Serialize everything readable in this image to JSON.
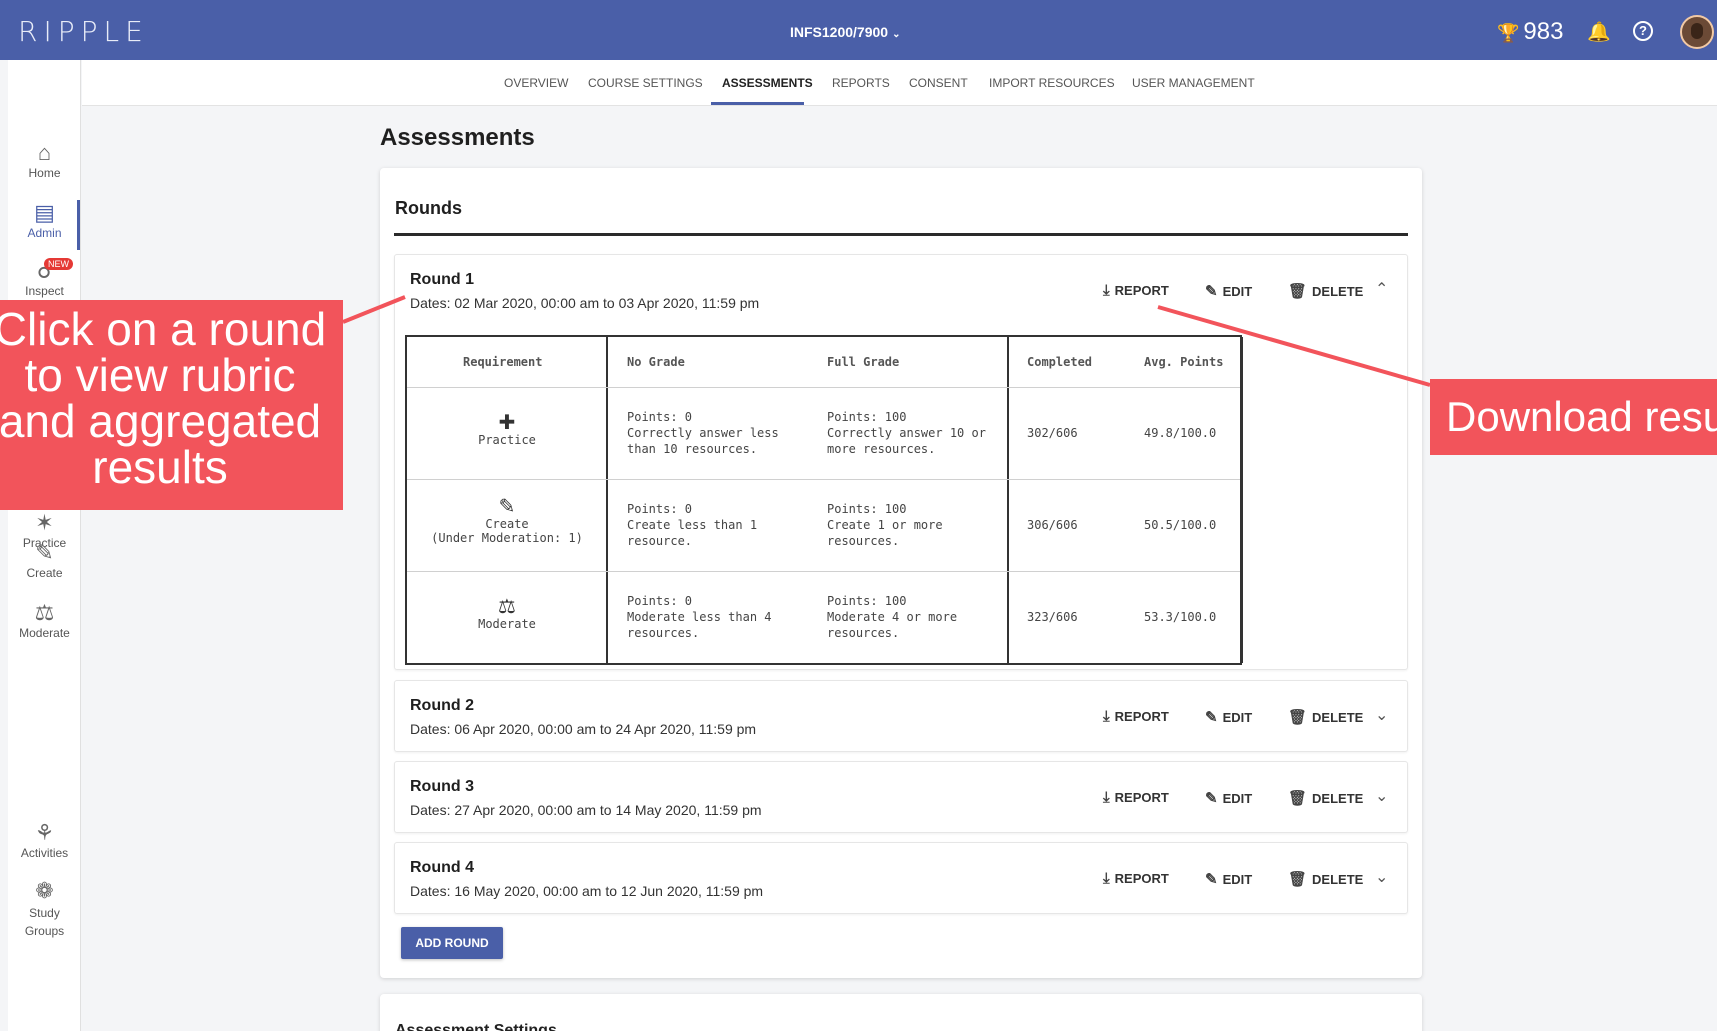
{
  "app": {
    "logo": "RIPPLE",
    "course": "INFS1200/7900",
    "points": "983",
    "icons": {
      "trophy": "trophy-icon",
      "bell": "bell-icon",
      "help": "help-icon"
    }
  },
  "sidebar": {
    "items": [
      {
        "label": "Home",
        "icon": "home-icon"
      },
      {
        "label": "Admin",
        "icon": "admin-icon"
      },
      {
        "label": "Inspect",
        "icon": "inspect-icon",
        "badge": "NEW"
      },
      {
        "label": "Practice",
        "icon": "practice-icon"
      },
      {
        "label": "Create",
        "icon": "create-icon"
      },
      {
        "label": "Moderate",
        "icon": "moderate-icon"
      },
      {
        "label": "Activities",
        "icon": "activities-icon"
      },
      {
        "label": "Study Groups",
        "icon": "study-groups-icon"
      }
    ]
  },
  "tabs": [
    "OVERVIEW",
    "COURSE SETTINGS",
    "ASSESSMENTS",
    "REPORTS",
    "CONSENT",
    "IMPORT RESOURCES",
    "USER MANAGEMENT"
  ],
  "active_tab": "ASSESSMENTS",
  "page": {
    "title": "Assessments",
    "rounds_title": "Rounds",
    "actions": {
      "report": "REPORT",
      "edit": "EDIT",
      "delete": "DELETE"
    },
    "add_round": "ADD ROUND",
    "next_section": "Assessment Settings"
  },
  "rounds": [
    {
      "name": "Round 1",
      "dates": "Dates: 02 Mar 2020, 00:00 am to 03 Apr 2020, 11:59 pm",
      "expanded": true
    },
    {
      "name": "Round 2",
      "dates": "Dates: 06 Apr 2020, 00:00 am to 24 Apr 2020, 11:59 pm",
      "expanded": false
    },
    {
      "name": "Round 3",
      "dates": "Dates: 27 Apr 2020, 00:00 am to 14 May 2020, 11:59 pm",
      "expanded": false
    },
    {
      "name": "Round 4",
      "dates": "Dates: 16 May 2020, 00:00 am to 12 Jun 2020, 11:59 pm",
      "expanded": false
    }
  ],
  "rubric": {
    "headers": [
      "Requirement",
      "No Grade",
      "Full Grade",
      "Completed",
      "Avg. Points"
    ],
    "rows": [
      {
        "requirement": "Practice",
        "sub": "",
        "icon": "dumbbell-icon",
        "no_grade": [
          "Points: 0",
          "Correctly answer less",
          "than 10 resources."
        ],
        "full_grade": [
          "Points: 100",
          "Correctly answer 10 or",
          "more resources."
        ],
        "completed": "302/606",
        "avg": "49.8/100.0"
      },
      {
        "requirement": "Create",
        "sub": "(Under Moderation: 1)",
        "icon": "pencil-icon",
        "no_grade": [
          "Points: 0",
          "Create less than 1",
          "resource."
        ],
        "full_grade": [
          "Points: 100",
          "Create 1 or more",
          "resources."
        ],
        "completed": "306/606",
        "avg": "50.5/100.0"
      },
      {
        "requirement": "Moderate",
        "sub": "",
        "icon": "gavel-icon",
        "no_grade": [
          "Points: 0",
          "Moderate less than 4",
          "resources."
        ],
        "full_grade": [
          "Points: 100",
          "Moderate 4 or more",
          "resources."
        ],
        "completed": "323/606",
        "avg": "53.3/100.0"
      }
    ]
  },
  "annotations": {
    "left": [
      "Click on a round",
      "to view rubric",
      "and aggregated",
      "results"
    ],
    "right": "Download results",
    "color": "#f2545b"
  },
  "colors": {
    "primary": "#4a5fa8",
    "badge": "#e53935"
  }
}
